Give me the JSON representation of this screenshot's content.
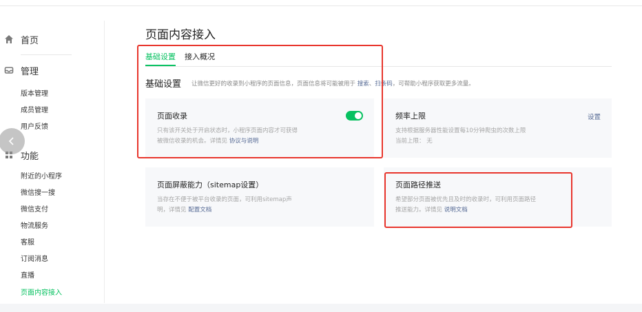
{
  "sidebar": {
    "home_label": "首页",
    "manage_label": "管理",
    "manage_items": [
      "版本管理",
      "成员管理",
      "用户反馈"
    ],
    "function_label": "功能",
    "function_items": [
      "附近的小程序",
      "微信搜一搜",
      "微信支付",
      "物流服务",
      "客服",
      "订阅消息",
      "直播",
      "页面内容接入"
    ],
    "active_item": "页面内容接入"
  },
  "page": {
    "title": "页面内容接入",
    "tabs": [
      {
        "label": "基础设置",
        "active": true
      },
      {
        "label": "接入概况",
        "active": false
      }
    ]
  },
  "section": {
    "title": "基础设置",
    "desc_prefix": "让微信更好的收录到小程序的页面信息，页面信息将可能被用于",
    "link_search": "搜索",
    "sep": "、",
    "link_scan": "扫条码",
    "desc_suffix": "，可帮助小程序获取更多流量。"
  },
  "cards": {
    "indexing": {
      "title": "页面收录",
      "desc_line1": "只有该开关处于开启状态时，小程序页面内容才可获得",
      "desc_line2_prefix": "被微信收录的机会。详情见",
      "link": "协议与说明",
      "toggle_on": true
    },
    "frequency": {
      "title": "频率上限",
      "action": "设置",
      "desc_line1": "支持根据服务器性能设置每10分钟爬虫的次数上限",
      "desc_line2": "当前上限： 无"
    },
    "blocking": {
      "title": "页面屏蔽能力（sitemap设置）",
      "desc_line1": "当存在不便于被平台收录的页面，可利用sitemap声",
      "desc_line2_prefix": "明，详情见",
      "link": "配置文档"
    },
    "push": {
      "title": "页面路径推送",
      "desc_line1": "希望部分页面被优先且及时的收录时，可利用页面路径",
      "desc_line2_prefix": "推送能力。详情见",
      "link": "说明文档"
    }
  },
  "colors": {
    "accent": "#07c160",
    "link": "#576b95",
    "highlight": "#e8342b"
  }
}
